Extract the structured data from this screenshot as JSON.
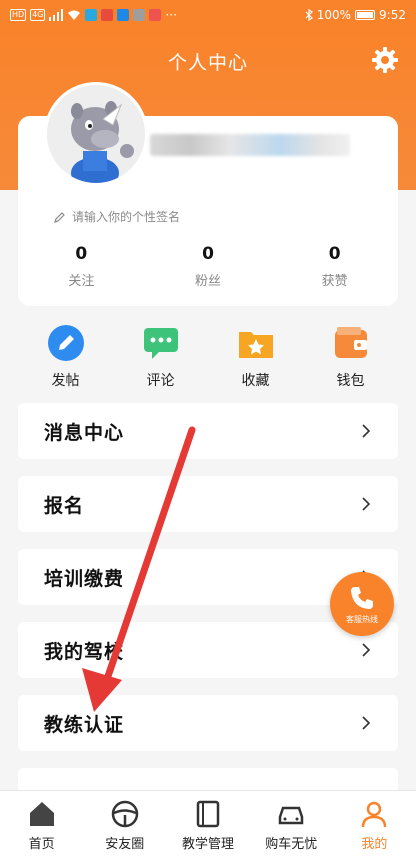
{
  "status_bar": {
    "left_tags": [
      "HD",
      "4G"
    ],
    "right_text": "100%",
    "time": "9:52",
    "dots": "···"
  },
  "header": {
    "title": "个人中心"
  },
  "profile": {
    "signature_placeholder": "请输入你的个性签名",
    "stats": [
      {
        "value": "0",
        "label": "关注"
      },
      {
        "value": "0",
        "label": "粉丝"
      },
      {
        "value": "0",
        "label": "获赞"
      }
    ]
  },
  "quick_actions": [
    {
      "label": "发帖",
      "icon": "pencil-icon",
      "color": "#2e8cf0"
    },
    {
      "label": "评论",
      "icon": "comment-icon",
      "color": "#3ec47a"
    },
    {
      "label": "收藏",
      "icon": "star-folder-icon",
      "color": "#f6a623"
    },
    {
      "label": "钱包",
      "icon": "wallet-icon",
      "color": "#f58a3a"
    }
  ],
  "menu": [
    {
      "label": "消息中心"
    },
    {
      "label": "报名"
    },
    {
      "label": "培训缴费"
    },
    {
      "label": "我的驾校"
    },
    {
      "label": "教练认证"
    }
  ],
  "service_button": {
    "label": "客服热线"
  },
  "bottom_nav": [
    {
      "label": "首页",
      "icon": "home-icon"
    },
    {
      "label": "安友圈",
      "icon": "steering-wheel-icon"
    },
    {
      "label": "教学管理",
      "icon": "book-icon"
    },
    {
      "label": "购车无忧",
      "icon": "car-icon"
    },
    {
      "label": "我的",
      "icon": "person-icon",
      "active": true
    }
  ],
  "colors": {
    "accent": "#f9832b",
    "arrow": "#e53935"
  }
}
